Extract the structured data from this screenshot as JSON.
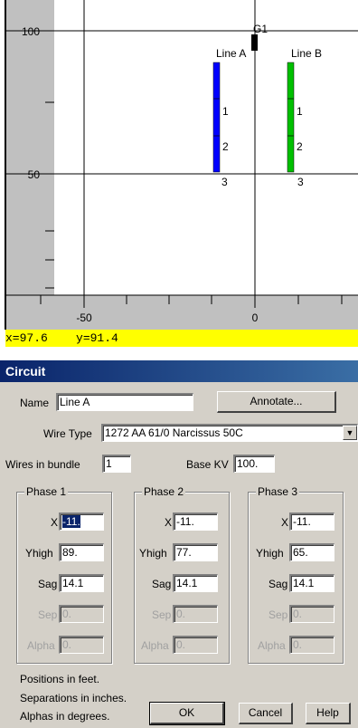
{
  "plot": {
    "y_ticks": [
      "100",
      "50"
    ],
    "x_ticks": [
      "-50",
      "0"
    ],
    "generator_label": "G1",
    "lines": [
      {
        "name": "Line A",
        "color": "#0000ff",
        "phase_labels": [
          "1",
          "2",
          "3"
        ]
      },
      {
        "name": "Line B",
        "color": "#00c000",
        "phase_labels": [
          "1",
          "2",
          "3"
        ]
      }
    ],
    "coord_readout": {
      "x_text": "x=97.6",
      "y_text": "y=91.4"
    }
  },
  "dialog": {
    "title": "Circuit",
    "name_label": "Name",
    "name_value": "Line A",
    "annotate_button": "Annotate...",
    "wire_type_label": "Wire Type",
    "wire_type_value": "1272 AA  61/0 Narcissus 50C",
    "wires_in_bundle_label": "Wires in bundle",
    "wires_in_bundle_value": "1",
    "base_kv_label": "Base KV",
    "base_kv_value": "100.",
    "phases": [
      {
        "title": "Phase 1",
        "x": "-11.",
        "yhigh": "89.",
        "sag": "14.1",
        "sep": "0.",
        "alpha": "0."
      },
      {
        "title": "Phase 2",
        "x": "-11.",
        "yhigh": "77.",
        "sag": "14.1",
        "sep": "0.",
        "alpha": "0."
      },
      {
        "title": "Phase 3",
        "x": "-11.",
        "yhigh": "65.",
        "sag": "14.1",
        "sep": "0.",
        "alpha": "0."
      }
    ],
    "field_labels": {
      "x": "X",
      "yhigh": "Yhigh",
      "sag": "Sag",
      "sep": "Sep",
      "alpha": "Alpha"
    },
    "notes": [
      "Positions in feet.",
      "Separations in inches.",
      "Alphas in degrees."
    ],
    "ok_button": "OK",
    "cancel_button": "Cancel",
    "help_button": "Help"
  }
}
